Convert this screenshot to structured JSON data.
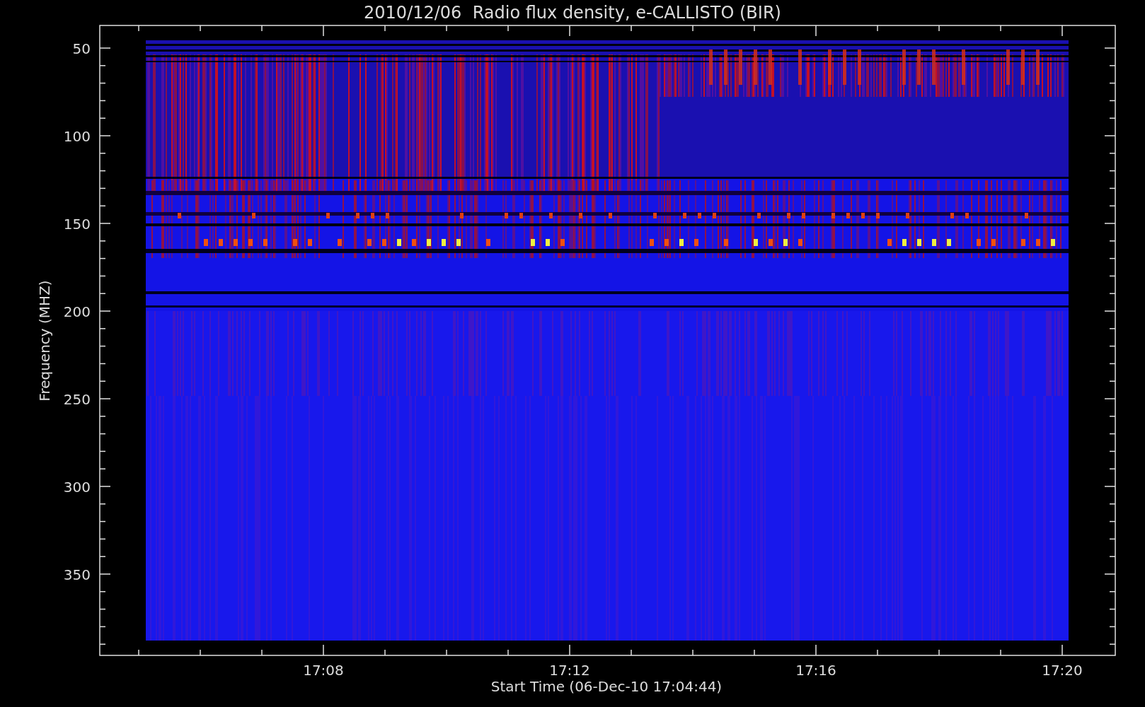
{
  "title": "2010/12/06  Radio flux density, e-CALLISTO (BIR)",
  "plot": {
    "ylabel": "Frequency (MHZ)",
    "xlabel": "Start Time (06-Dec-10 17:04:44)",
    "yticks": [
      "50",
      "100",
      "150",
      "200",
      "250",
      "300",
      "350"
    ],
    "xticks": [
      "17:08",
      "17:12",
      "17:16",
      "17:20"
    ]
  }
}
